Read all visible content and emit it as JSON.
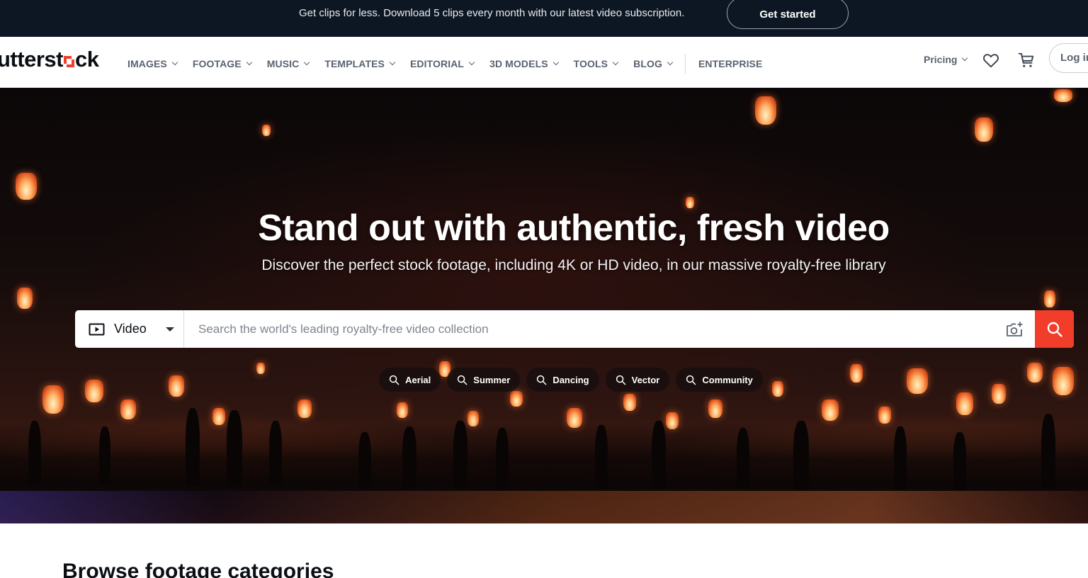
{
  "promo": {
    "text": "Get clips for less. Download 5 clips every month with our latest video subscription.",
    "button": "Get started"
  },
  "nav": {
    "logo_dark": "utterst",
    "logo_red": "",
    "logo_tail": "ck",
    "items": [
      {
        "label": "IMAGES"
      },
      {
        "label": "FOOTAGE"
      },
      {
        "label": "MUSIC"
      },
      {
        "label": "TEMPLATES"
      },
      {
        "label": "EDITORIAL"
      },
      {
        "label": "3D MODELS"
      },
      {
        "label": "TOOLS"
      },
      {
        "label": "BLOG"
      }
    ],
    "enterprise": "ENTERPRISE",
    "pricing": "Pricing",
    "login": "Log in",
    "icons": [
      "heart-icon",
      "cart-icon",
      "chevron-down-icon"
    ]
  },
  "hero": {
    "title": "Stand out with authentic, fresh video",
    "subtitle": "Discover the perfect stock footage, including 4K or HD video, in our massive royalty-free library",
    "media_type": "Video",
    "search_placeholder": "Search the world's leading royalty-free video collection",
    "chips": [
      "Aerial",
      "Summer",
      "Dancing",
      "Vector",
      "Community"
    ],
    "icons": [
      "play-box-icon",
      "camera-search-icon",
      "search-icon"
    ]
  },
  "browse": {
    "title": "Browse footage categories"
  },
  "colors": {
    "brand_red": "#f23d2b",
    "promo_bg": "#0d1724",
    "nav_text": "#5a6370"
  }
}
